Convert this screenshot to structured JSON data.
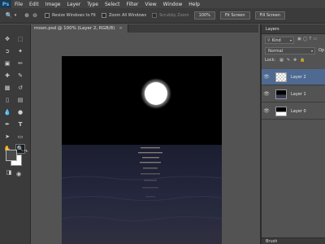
{
  "menubar": {
    "logo": "Ps",
    "items": [
      "File",
      "Edit",
      "Image",
      "Layer",
      "Type",
      "Select",
      "Filter",
      "View",
      "Window",
      "Help"
    ]
  },
  "options": {
    "resize_windows": "Resize Windows to Fit",
    "zoom_all": "Zoom All Windows",
    "scrubby_zoom": "Scrubby Zoom",
    "zoom_100": "100%",
    "fit_screen": "Fit Screen",
    "fill_screen": "Fill Screen"
  },
  "document": {
    "tab_title": "moon.psd @ 100% (Layer 2, RGB/8)",
    "close_glyph": "×"
  },
  "layers_panel": {
    "title": "Layers",
    "kind_label": "Kind",
    "blend_mode": "Normal",
    "opacity_label": "Op",
    "lock_label": "Lock:",
    "layers": [
      {
        "name": "Layer 2",
        "selected": true
      },
      {
        "name": "Layer 1",
        "selected": false
      },
      {
        "name": "Layer 0",
        "selected": false
      }
    ],
    "brush_tab": "Brush"
  },
  "colors": {
    "accent": "#4f6a91",
    "sky": "#000000",
    "moon": "#ffffff"
  }
}
